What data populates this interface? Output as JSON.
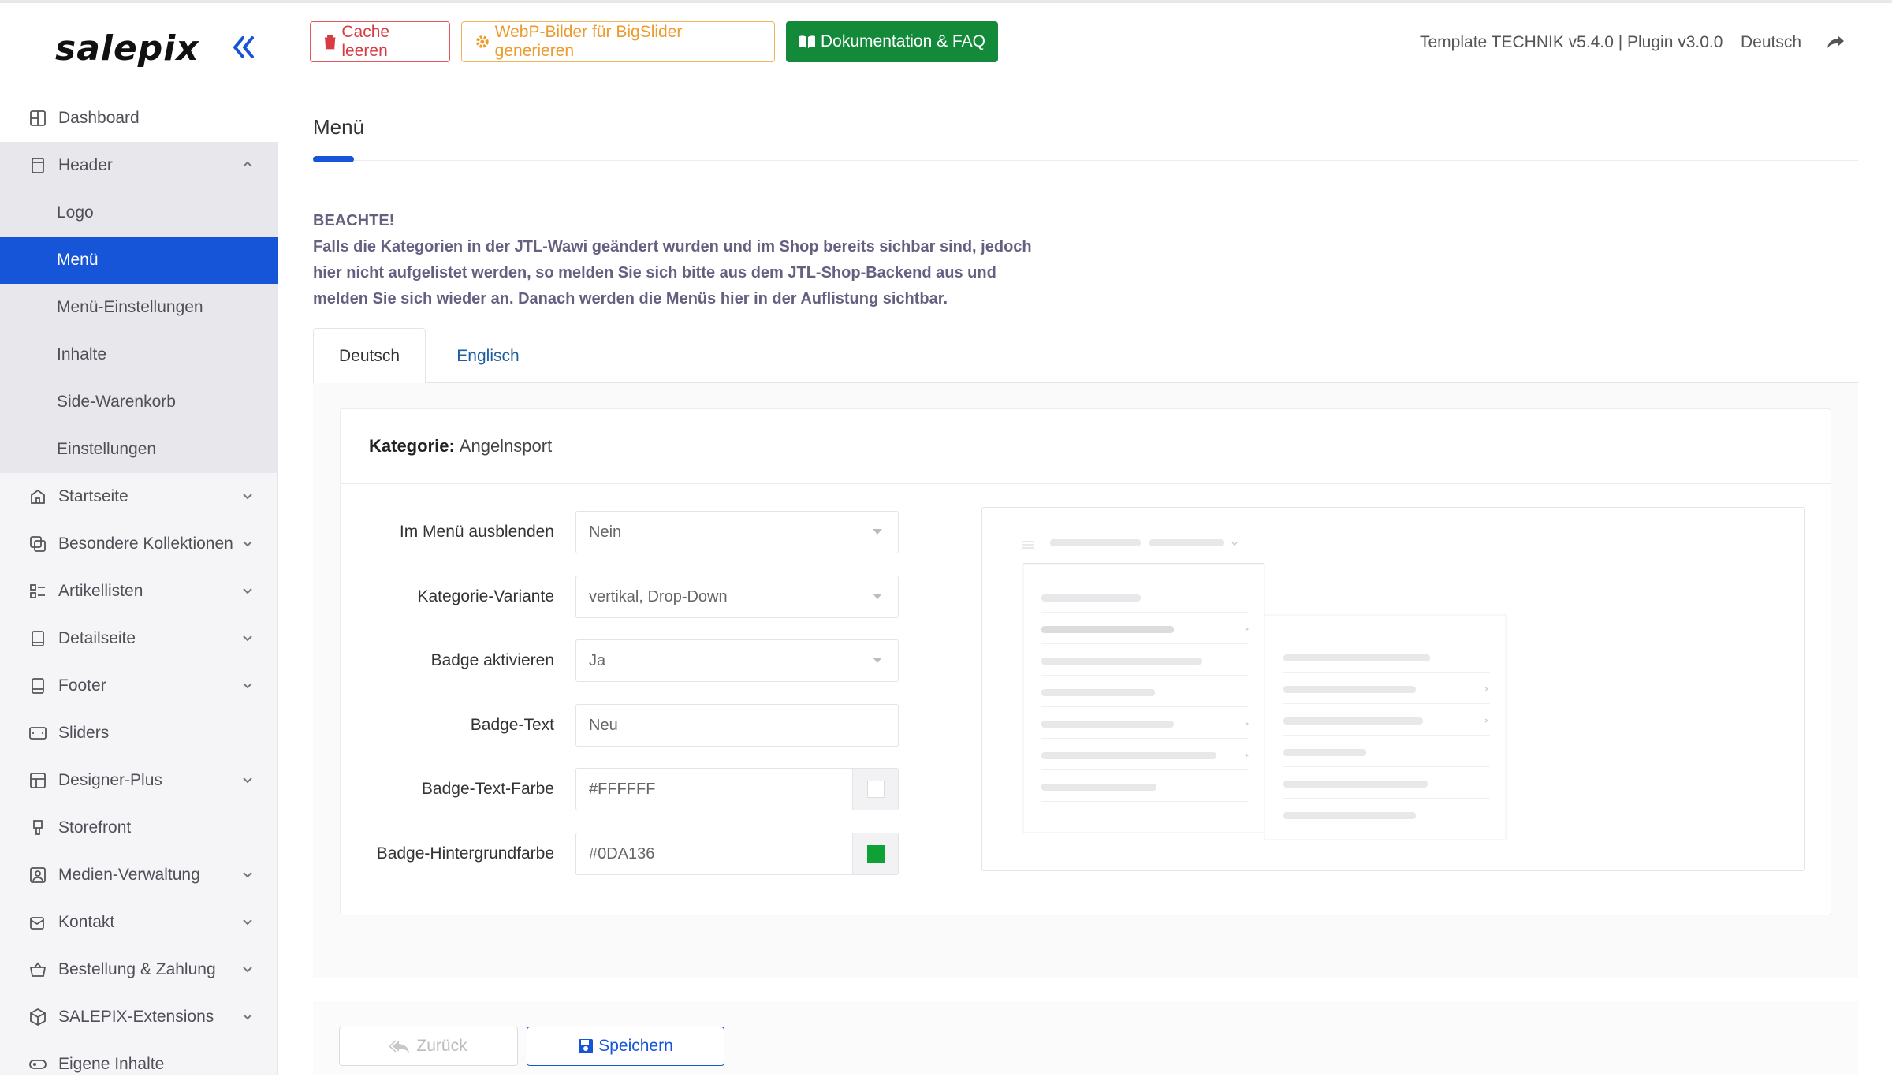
{
  "app": {
    "logo": "salepix"
  },
  "sidebar": {
    "items": [
      {
        "label": "Dashboard",
        "icon": "dashboard-icon"
      },
      {
        "label": "Header",
        "icon": "header-icon",
        "expanded": true
      },
      {
        "label": "Startseite",
        "icon": "home-icon"
      },
      {
        "label": "Besondere Kollektionen",
        "icon": "collections-icon"
      },
      {
        "label": "Artikellisten",
        "icon": "list-icon"
      },
      {
        "label": "Detailseite",
        "icon": "detail-icon"
      },
      {
        "label": "Footer",
        "icon": "footer-icon"
      },
      {
        "label": "Sliders",
        "icon": "slider-icon"
      },
      {
        "label": "Designer-Plus",
        "icon": "designer-icon"
      },
      {
        "label": "Storefront",
        "icon": "storefront-icon"
      },
      {
        "label": "Medien-Verwaltung",
        "icon": "media-icon"
      },
      {
        "label": "Kontakt",
        "icon": "contact-icon"
      },
      {
        "label": "Bestellung & Zahlung",
        "icon": "basket-icon"
      },
      {
        "label": "SALEPIX-Extensions",
        "icon": "extensions-icon"
      },
      {
        "label": "Eigene Inhalte",
        "icon": "custom-content-icon"
      }
    ],
    "header_sub": [
      "Logo",
      "Menü",
      "Menü-Einstellungen",
      "Inhalte",
      "Side-Warenkorb",
      "Einstellungen"
    ],
    "active_sub": "Menü"
  },
  "topbar": {
    "cache_label": "Cache leeren",
    "webp_label": "WebP-Bilder für BigSlider generieren",
    "doku_label": "Dokumentation & FAQ",
    "version": "Template TECHNIK v5.4.0 | Plugin v3.0.0",
    "language": "Deutsch"
  },
  "page": {
    "title": "Menü",
    "notice_title": "BEACHTE!",
    "notice_text": "Falls die Kategorien in der JTL-Wawi geändert wurden und im Shop bereits sichbar sind, jedoch hier nicht aufgelistet werden, so melden Sie sich bitte aus dem JTL-Shop-Backend aus und melden Sie sich wieder an. Danach werden die Menüs hier in der Auflistung sichtbar.",
    "tabs": [
      "Deutsch",
      "Englisch"
    ],
    "category_label": "Kategorie:",
    "category_value": "Angelnsport"
  },
  "form": {
    "hide_label": "Im Menü ausblenden",
    "hide_value": "Nein",
    "variant_label": "Kategorie-Variante",
    "variant_value": "vertikal, Drop-Down",
    "badge_label": "Badge aktivieren",
    "badge_value": "Ja",
    "badge_text_label": "Badge-Text",
    "badge_text_value": "Neu",
    "badge_color_label": "Badge-Text-Farbe",
    "badge_color_value": "#FFFFFF",
    "badge_bg_label": "Badge-Hintergrundfarbe",
    "badge_bg_value": "#0DA136"
  },
  "actions": {
    "back_label": "Zurück",
    "save_label": "Speichern"
  },
  "colors": {
    "accent": "#1755d8",
    "success": "#138a3a",
    "danger": "#d63c42",
    "warning": "#ec9b2c"
  }
}
